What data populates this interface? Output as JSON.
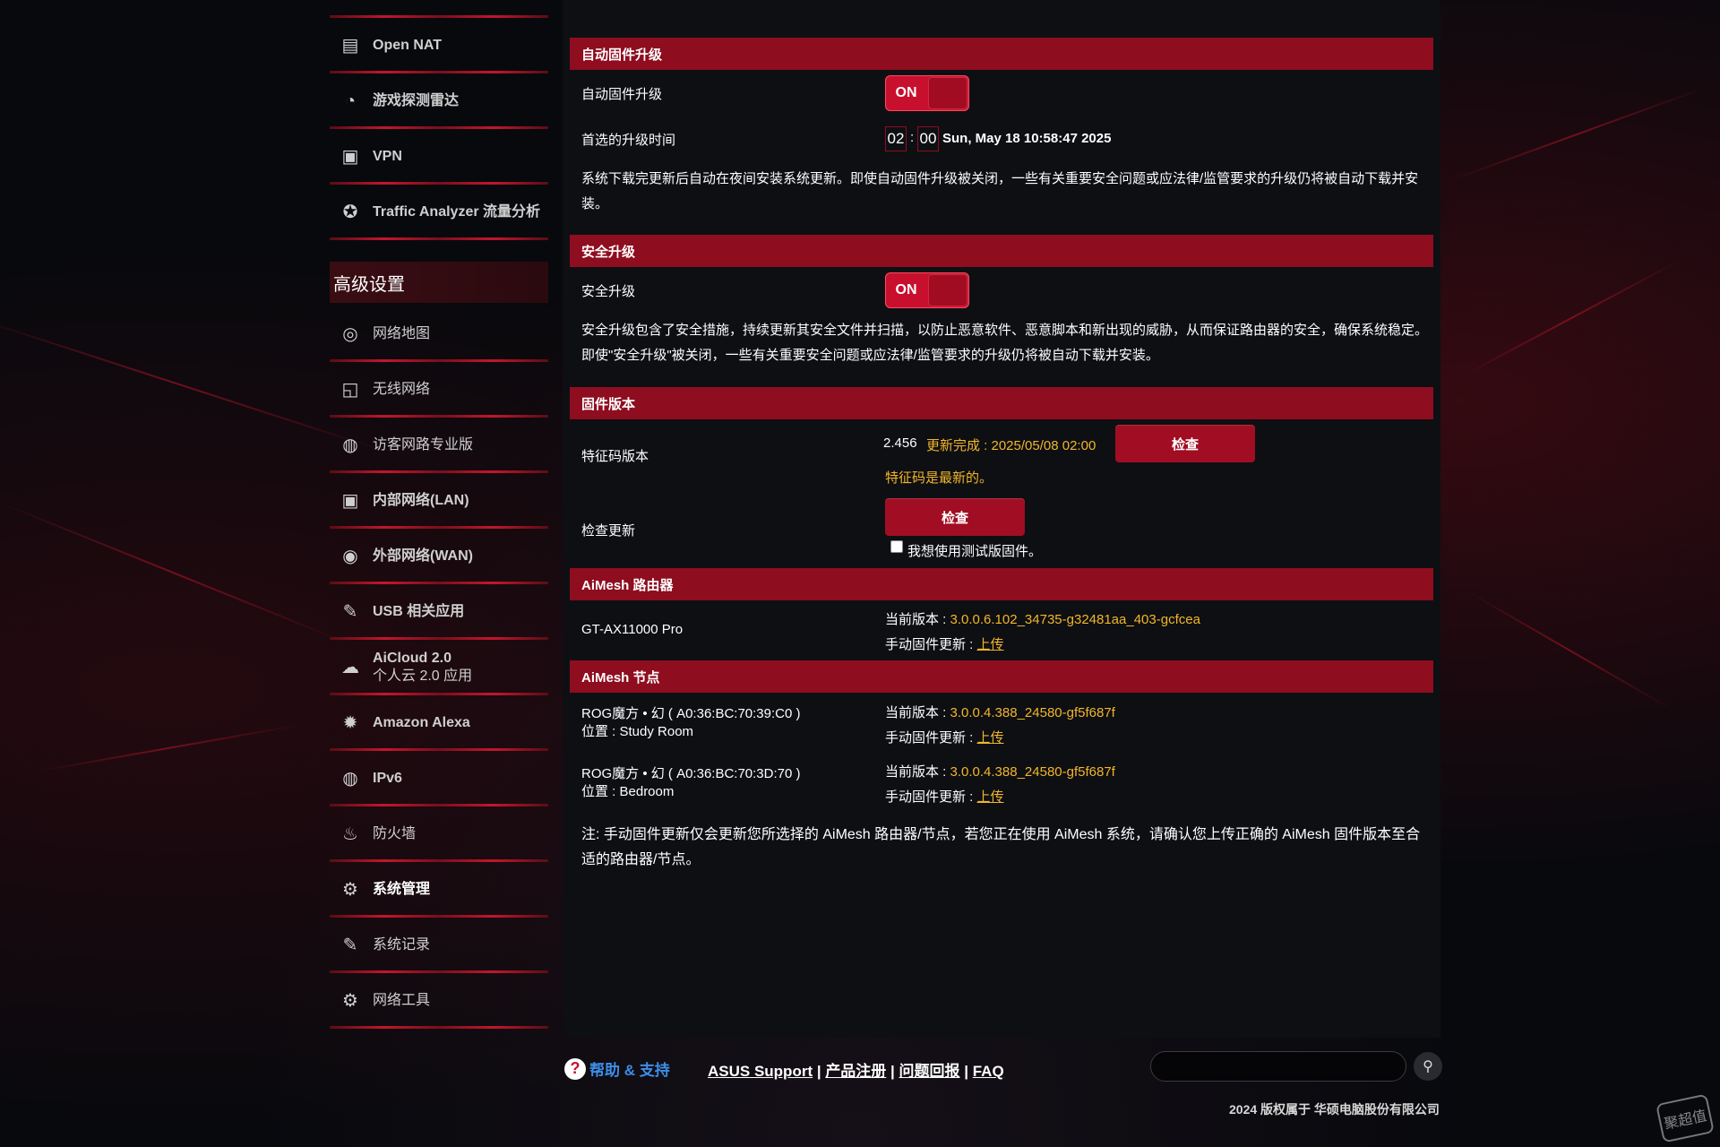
{
  "sidebar": {
    "items_top": [
      {
        "label": "Open NAT",
        "icon": "open-nat-icon",
        "glyph": "▤"
      },
      {
        "label": "游戏探测雷达",
        "icon": "radar-icon",
        "glyph": "◔"
      },
      {
        "label": "VPN",
        "icon": "vpn-icon",
        "glyph": "▣"
      },
      {
        "label": "Traffic Analyzer 流量分析",
        "icon": "traffic-analyzer-icon",
        "glyph": "✪"
      }
    ],
    "section_title": "高级设置",
    "items_advanced": [
      {
        "label": "网络地图",
        "icon": "network-map-icon",
        "glyph": "◎"
      },
      {
        "label": "无线网络",
        "icon": "wireless-icon",
        "glyph": "◱"
      },
      {
        "label": "访客网路专业版",
        "icon": "guest-network-icon",
        "glyph": "◍"
      },
      {
        "label": "内部网络(LAN)",
        "icon": "lan-icon",
        "glyph": "▣"
      },
      {
        "label": "外部网络(WAN)",
        "icon": "wan-icon",
        "glyph": "◉"
      },
      {
        "label": "USB 相关应用",
        "icon": "usb-icon",
        "glyph": "✎"
      },
      {
        "label": "AiCloud 2.0",
        "label2": "个人云 2.0 应用",
        "icon": "aicloud-icon",
        "glyph": "☁"
      },
      {
        "label": "Amazon Alexa",
        "icon": "alexa-icon",
        "glyph": "✹"
      },
      {
        "label": "IPv6",
        "icon": "ipv6-icon",
        "glyph": "◍"
      },
      {
        "label": "防火墙",
        "icon": "firewall-icon",
        "glyph": "♨"
      },
      {
        "label": "系统管理",
        "icon": "administration-icon",
        "glyph": "⚙",
        "active": true
      },
      {
        "label": "系统记录",
        "icon": "system-log-icon",
        "glyph": "✎"
      },
      {
        "label": "网络工具",
        "icon": "network-tools-icon",
        "glyph": "⚙"
      }
    ]
  },
  "auto_upgrade": {
    "title": "自动固件升级",
    "toggle_label": "自动固件升级",
    "toggle_state": "ON",
    "time_label": "首选的升级时间",
    "hour": "02",
    "sep": ":",
    "minute": "00",
    "datetime": "Sun, May 18 10:58:47 2025",
    "desc": "系统下载完更新后自动在夜间安装系统更新。即使自动固件升级被关闭，一些有关重要安全问题或应法律/监管要求的升级仍将被自动下载并安装。"
  },
  "security_upgrade": {
    "title": "安全升级",
    "toggle_label": "安全升级",
    "toggle_state": "ON",
    "desc": "安全升级包含了安全措施，持续更新其安全文件并扫描，以防止恶意软件、恶意脚本和新出现的威胁，从而保证路由器的安全，确保系统稳定。即使\"安全升级\"被关闭，一些有关重要安全问题或应法律/监管要求的升级仍将被自动下载并安装。"
  },
  "firmware": {
    "title": "固件版本",
    "sig_label": "特征码版本",
    "sig_version": "2.456",
    "sig_status": "更新完成 : 2025/05/08 02:00",
    "sig_latest": "特征码是最新的。",
    "check_label": "检查",
    "update_label": "检查更新",
    "check_label2": "检查",
    "beta_label": "我想使用测试版固件。"
  },
  "aimesh_router": {
    "title": "AiMesh 路由器",
    "model": "GT-AX11000 Pro",
    "current_version_label": "当前版本 : ",
    "current_version": "3.0.0.6.102_34735-g32481aa_403-gcfcea",
    "manual_label": "手动固件更新 : ",
    "upload": "上传"
  },
  "aimesh_nodes": {
    "title": "AiMesh 节点",
    "nodes": [
      {
        "name": "ROG魔方 • 幻 ( A0:36:BC:70:39:C0 )",
        "location": "位置 : Study Room",
        "current_version_label": "当前版本 : ",
        "version": "3.0.0.4.388_24580-gf5f687f",
        "manual_label": "手动固件更新 : ",
        "upload": "上传"
      },
      {
        "name": "ROG魔方 • 幻 ( A0:36:BC:70:3D:70 )",
        "location": "位置 : Bedroom",
        "current_version_label": "当前版本 : ",
        "version": "3.0.0.4.388_24580-gf5f687f",
        "manual_label": "手动固件更新 : ",
        "upload": "上传"
      }
    ],
    "note": "注:  手动固件更新仅会更新您所选择的 AiMesh 路由器/节点，若您正在使用 AiMesh 系统，请确认您上传正确的 AiMesh 固件版本至合适的路由器/节点。"
  },
  "footer": {
    "help": "帮助 & 支持",
    "links": [
      "ASUS Support",
      "产品注册",
      "问题回报",
      "FAQ"
    ],
    "separator": " | ",
    "copyright": "2024 版权属于 华硕电脑股份有限公司",
    "watermark": "聚超值"
  },
  "colors": {
    "accent": "#8e0d1f",
    "toggle": "#c8102e",
    "highlight": "#f2b62b",
    "help_link": "#3d8ee8"
  }
}
